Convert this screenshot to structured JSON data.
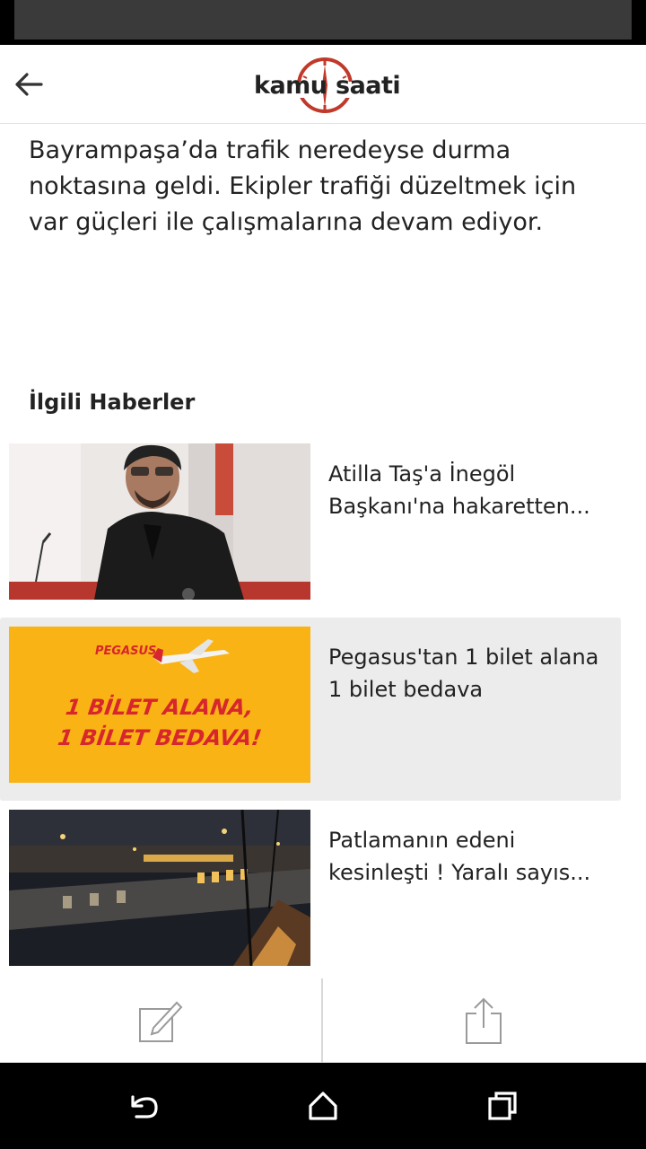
{
  "header": {
    "back_icon": "arrow-left-icon",
    "logo_left": "kamu",
    "logo_right": "saati",
    "logo_accent": "#c0392b"
  },
  "article": {
    "text": "Bayrampaşa’da trafik neredeyse durma noktasına geldi. Ekipler trafiği düzeltmek için var güçleri ile çalışmalarına devam ediyor."
  },
  "related": {
    "title": "İlgili Haberler",
    "items": [
      {
        "title": "Atilla Taş'a İnegöl Başkanı'na hakaretten..."
      },
      {
        "title": "Pegasus'tan 1 bilet alana 1 bilet bedava",
        "ad_brand": "PEGASUS",
        "ad_line1": "1 BİLET ALANA,",
        "ad_line2": "1 BİLET BEDAVA!"
      },
      {
        "title": "Patlamanın edeni kesinleşti ! Yaralı sayıs..."
      }
    ]
  },
  "actions": {
    "edit_icon": "edit-icon",
    "share_icon": "share-icon"
  },
  "navigation": {
    "back_icon": "back-nav-icon",
    "home_icon": "home-icon",
    "recents_icon": "recents-icon"
  },
  "colors": {
    "accent": "#c0392b",
    "ad_yellow": "#f9b314",
    "ad_red": "#d7262d",
    "highlight": "#ececec"
  }
}
